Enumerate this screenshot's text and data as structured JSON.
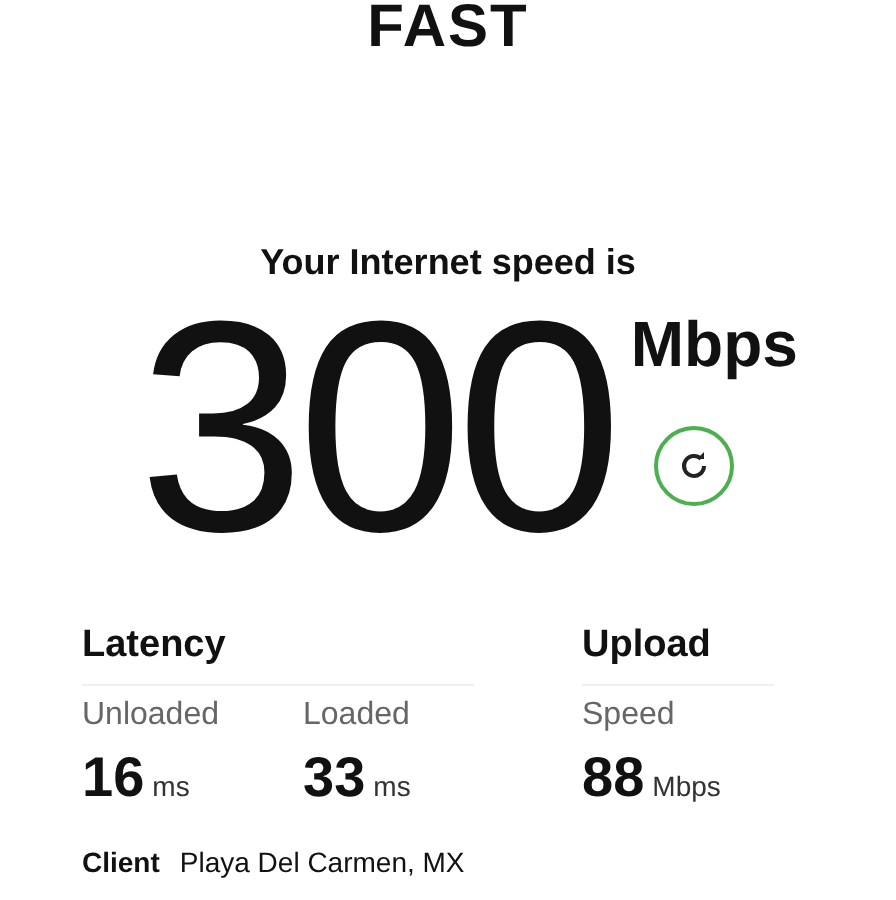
{
  "logo": "FAST",
  "heading": "Your Internet speed is",
  "speed": {
    "value": "300",
    "unit": "Mbps"
  },
  "latency": {
    "title": "Latency",
    "metrics": [
      {
        "label": "Unloaded",
        "value": "16",
        "unit": "ms"
      },
      {
        "label": "Loaded",
        "value": "33",
        "unit": "ms"
      }
    ]
  },
  "upload": {
    "title": "Upload",
    "metrics": [
      {
        "label": "Speed",
        "value": "88",
        "unit": "Mbps"
      }
    ]
  },
  "client": {
    "label": "Client",
    "value": "Playa Del Carmen, MX"
  }
}
